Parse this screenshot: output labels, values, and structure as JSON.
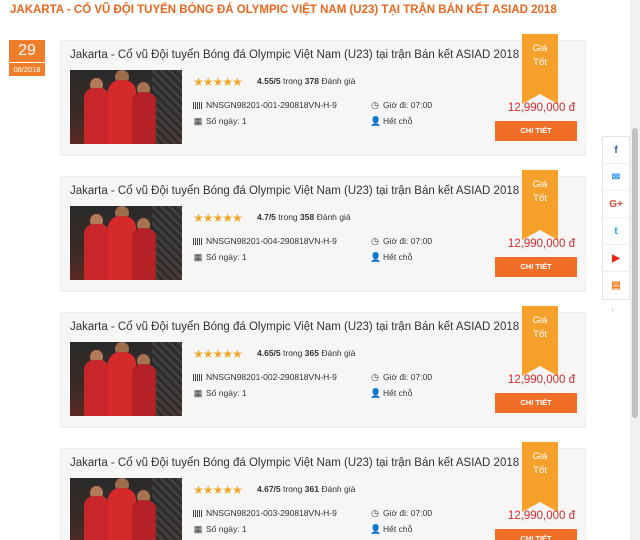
{
  "page": {
    "title": "JAKARTA - CỔ VŨ ĐỘI TUYỂN BÓNG ĐÁ OLYMPIC VIỆT NAM (U23) TẠI TRẬN BÁN KẾT ASIAD 2018"
  },
  "date_badge": {
    "day": "29",
    "month": "08/2018"
  },
  "tours": [
    {
      "title": "Jakarta - Cổ vũ Đội tuyển Bóng đá Olympic Việt Nam (U23) tại trận Bán kết ASIAD 2018",
      "stars": "★★★★★",
      "rating_value": 4.55,
      "score": "4.55/5",
      "rating_word": "trong",
      "review_count": "378",
      "review_label": "Đánh giá",
      "code": "NNSGN98201-001-290818VN-H-9",
      "departure_label": "Giờ đi:",
      "departure_time": "07:00",
      "days_label": "Số ngày:",
      "days": "1",
      "seats": "Hết chỗ",
      "ribbon_line1": "Giá",
      "ribbon_line2": "Tốt",
      "price": "12,990,000 đ",
      "button": "CHI TIẾT"
    },
    {
      "title": "Jakarta - Cổ vũ Đội tuyển Bóng đá Olympic Việt Nam (U23) tại trận Bán kết ASIAD 2018",
      "stars": "★★★★★",
      "rating_value": 4.7,
      "score": "4.7/5",
      "rating_word": "trong",
      "review_count": "358",
      "review_label": "Đánh giá",
      "code": "NNSGN98201-004-290818VN-H-9",
      "departure_label": "Giờ đi:",
      "departure_time": "07:00",
      "days_label": "Số ngày:",
      "days": "1",
      "seats": "Hết chỗ",
      "ribbon_line1": "Giá",
      "ribbon_line2": "Tốt",
      "price": "12,990,000 đ",
      "button": "CHI TIẾT"
    },
    {
      "title": "Jakarta - Cổ vũ Đội tuyển Bóng đá Olympic Việt Nam (U23) tại trận Bán kết ASIAD 2018",
      "stars": "★★★★★",
      "rating_value": 4.65,
      "score": "4.65/5",
      "rating_word": "trong",
      "review_count": "365",
      "review_label": "Đánh giá",
      "code": "NNSGN98201-002-290818VN-H-9",
      "departure_label": "Giờ đi:",
      "departure_time": "07:00",
      "days_label": "Số ngày:",
      "days": "1",
      "seats": "Hết chỗ",
      "ribbon_line1": "Giá",
      "ribbon_line2": "Tốt",
      "price": "12,990,000 đ",
      "button": "CHI TIẾT"
    },
    {
      "title": "Jakarta - Cổ vũ Đội tuyển Bóng đá Olympic Việt Nam (U23) tại trận Bán kết ASIAD 2018",
      "stars": "★★★★★",
      "rating_value": 4.67,
      "score": "4.67/5",
      "rating_word": "trong",
      "review_count": "361",
      "review_label": "Đánh giá",
      "code": "NNSGN98201-003-290818VN-H-9",
      "departure_label": "Giờ đi:",
      "departure_time": "07:00",
      "days_label": "Số ngày:",
      "days": "1",
      "seats": "Hết chỗ",
      "ribbon_line1": "Giá",
      "ribbon_line2": "Tốt",
      "price": "12,990,000 đ",
      "button": "CHI TIẾT"
    }
  ],
  "social": {
    "items": [
      {
        "icon": "facebook-icon",
        "glyph": "f"
      },
      {
        "icon": "messenger-icon",
        "glyph": "✉"
      },
      {
        "icon": "google-plus-icon",
        "glyph": "G+"
      },
      {
        "icon": "twitter-icon",
        "glyph": "t"
      },
      {
        "icon": "youtube-icon",
        "glyph": "▶"
      },
      {
        "icon": "bookmark-icon",
        "glyph": "▤"
      }
    ],
    "arrow": "›"
  },
  "colors": {
    "accent": "#f07d2a",
    "button": "#f06e27",
    "price": "#d02c2c",
    "ribbon": "#f5a12b",
    "stars": "#f0a92a"
  }
}
